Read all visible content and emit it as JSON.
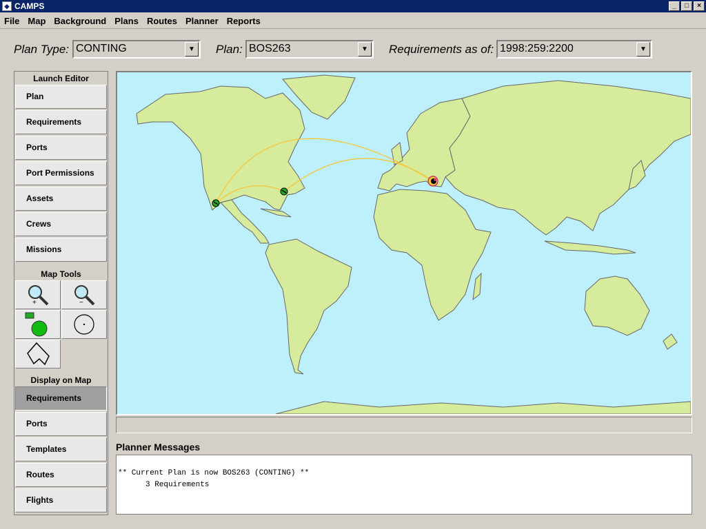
{
  "window": {
    "title": "CAMPS",
    "minimize": "_",
    "maximize": "□",
    "close": "×"
  },
  "menu": [
    "File",
    "Map",
    "Background",
    "Plans",
    "Routes",
    "Planner",
    "Reports"
  ],
  "controls": {
    "plan_type": {
      "label": "Plan Type:",
      "value": "CONTING"
    },
    "plan": {
      "label": "Plan:",
      "value": "BOS263"
    },
    "requirements_as_of": {
      "label": "Requirements as of:",
      "value": "1998:259:2200"
    }
  },
  "sidebar": {
    "launch_editor": {
      "title": "Launch Editor",
      "items": [
        "Plan",
        "Requirements",
        "Ports",
        "Port Permissions",
        "Assets",
        "Crews",
        "Missions"
      ]
    },
    "map_tools": {
      "title": "Map Tools",
      "tools": [
        "zoom-in-icon",
        "zoom-out-icon",
        "add-location-icon",
        "point-select-icon",
        "polygon-select-icon"
      ]
    },
    "display_on_map": {
      "title": "Display on Map",
      "items": [
        "Requirements",
        "Ports",
        "Templates",
        "Routes",
        "Flights"
      ],
      "active": "Requirements"
    }
  },
  "map": {
    "ocean_color": "#bdf0fb",
    "land_color": "#d6eb9c",
    "border_color": "#666666",
    "route_color": "#f6c73a",
    "markers": [
      {
        "name": "west-coast-port",
        "color": "#22aa22"
      },
      {
        "name": "east-coast-port",
        "color": "#22aa22"
      },
      {
        "name": "europe-destination",
        "color": "#cc3366"
      }
    ]
  },
  "messages": {
    "title": "Planner Messages",
    "lines": [
      "** Current Plan is now BOS263 (CONTING) **",
      "3 Requirements"
    ]
  }
}
